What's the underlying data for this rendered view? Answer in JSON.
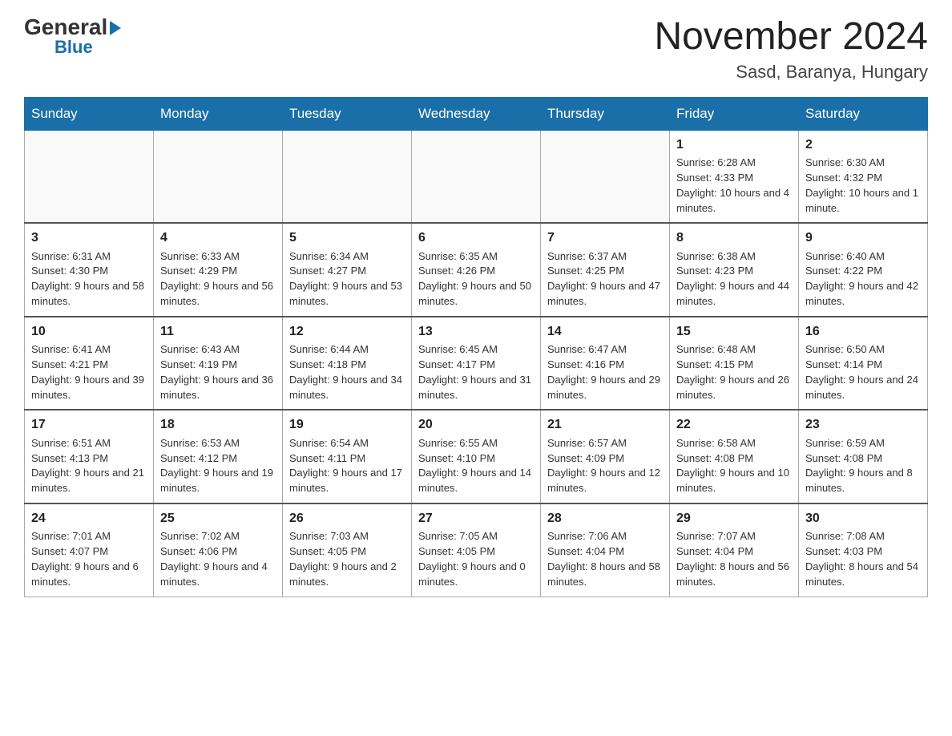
{
  "header": {
    "logo_general": "General",
    "logo_blue": "Blue",
    "month_title": "November 2024",
    "location": "Sasd, Baranya, Hungary"
  },
  "weekdays": [
    "Sunday",
    "Monday",
    "Tuesday",
    "Wednesday",
    "Thursday",
    "Friday",
    "Saturday"
  ],
  "weeks": [
    [
      {
        "day": "",
        "info": ""
      },
      {
        "day": "",
        "info": ""
      },
      {
        "day": "",
        "info": ""
      },
      {
        "day": "",
        "info": ""
      },
      {
        "day": "",
        "info": ""
      },
      {
        "day": "1",
        "info": "Sunrise: 6:28 AM\nSunset: 4:33 PM\nDaylight: 10 hours and 4 minutes."
      },
      {
        "day": "2",
        "info": "Sunrise: 6:30 AM\nSunset: 4:32 PM\nDaylight: 10 hours and 1 minute."
      }
    ],
    [
      {
        "day": "3",
        "info": "Sunrise: 6:31 AM\nSunset: 4:30 PM\nDaylight: 9 hours and 58 minutes."
      },
      {
        "day": "4",
        "info": "Sunrise: 6:33 AM\nSunset: 4:29 PM\nDaylight: 9 hours and 56 minutes."
      },
      {
        "day": "5",
        "info": "Sunrise: 6:34 AM\nSunset: 4:27 PM\nDaylight: 9 hours and 53 minutes."
      },
      {
        "day": "6",
        "info": "Sunrise: 6:35 AM\nSunset: 4:26 PM\nDaylight: 9 hours and 50 minutes."
      },
      {
        "day": "7",
        "info": "Sunrise: 6:37 AM\nSunset: 4:25 PM\nDaylight: 9 hours and 47 minutes."
      },
      {
        "day": "8",
        "info": "Sunrise: 6:38 AM\nSunset: 4:23 PM\nDaylight: 9 hours and 44 minutes."
      },
      {
        "day": "9",
        "info": "Sunrise: 6:40 AM\nSunset: 4:22 PM\nDaylight: 9 hours and 42 minutes."
      }
    ],
    [
      {
        "day": "10",
        "info": "Sunrise: 6:41 AM\nSunset: 4:21 PM\nDaylight: 9 hours and 39 minutes."
      },
      {
        "day": "11",
        "info": "Sunrise: 6:43 AM\nSunset: 4:19 PM\nDaylight: 9 hours and 36 minutes."
      },
      {
        "day": "12",
        "info": "Sunrise: 6:44 AM\nSunset: 4:18 PM\nDaylight: 9 hours and 34 minutes."
      },
      {
        "day": "13",
        "info": "Sunrise: 6:45 AM\nSunset: 4:17 PM\nDaylight: 9 hours and 31 minutes."
      },
      {
        "day": "14",
        "info": "Sunrise: 6:47 AM\nSunset: 4:16 PM\nDaylight: 9 hours and 29 minutes."
      },
      {
        "day": "15",
        "info": "Sunrise: 6:48 AM\nSunset: 4:15 PM\nDaylight: 9 hours and 26 minutes."
      },
      {
        "day": "16",
        "info": "Sunrise: 6:50 AM\nSunset: 4:14 PM\nDaylight: 9 hours and 24 minutes."
      }
    ],
    [
      {
        "day": "17",
        "info": "Sunrise: 6:51 AM\nSunset: 4:13 PM\nDaylight: 9 hours and 21 minutes."
      },
      {
        "day": "18",
        "info": "Sunrise: 6:53 AM\nSunset: 4:12 PM\nDaylight: 9 hours and 19 minutes."
      },
      {
        "day": "19",
        "info": "Sunrise: 6:54 AM\nSunset: 4:11 PM\nDaylight: 9 hours and 17 minutes."
      },
      {
        "day": "20",
        "info": "Sunrise: 6:55 AM\nSunset: 4:10 PM\nDaylight: 9 hours and 14 minutes."
      },
      {
        "day": "21",
        "info": "Sunrise: 6:57 AM\nSunset: 4:09 PM\nDaylight: 9 hours and 12 minutes."
      },
      {
        "day": "22",
        "info": "Sunrise: 6:58 AM\nSunset: 4:08 PM\nDaylight: 9 hours and 10 minutes."
      },
      {
        "day": "23",
        "info": "Sunrise: 6:59 AM\nSunset: 4:08 PM\nDaylight: 9 hours and 8 minutes."
      }
    ],
    [
      {
        "day": "24",
        "info": "Sunrise: 7:01 AM\nSunset: 4:07 PM\nDaylight: 9 hours and 6 minutes."
      },
      {
        "day": "25",
        "info": "Sunrise: 7:02 AM\nSunset: 4:06 PM\nDaylight: 9 hours and 4 minutes."
      },
      {
        "day": "26",
        "info": "Sunrise: 7:03 AM\nSunset: 4:05 PM\nDaylight: 9 hours and 2 minutes."
      },
      {
        "day": "27",
        "info": "Sunrise: 7:05 AM\nSunset: 4:05 PM\nDaylight: 9 hours and 0 minutes."
      },
      {
        "day": "28",
        "info": "Sunrise: 7:06 AM\nSunset: 4:04 PM\nDaylight: 8 hours and 58 minutes."
      },
      {
        "day": "29",
        "info": "Sunrise: 7:07 AM\nSunset: 4:04 PM\nDaylight: 8 hours and 56 minutes."
      },
      {
        "day": "30",
        "info": "Sunrise: 7:08 AM\nSunset: 4:03 PM\nDaylight: 8 hours and 54 minutes."
      }
    ]
  ]
}
